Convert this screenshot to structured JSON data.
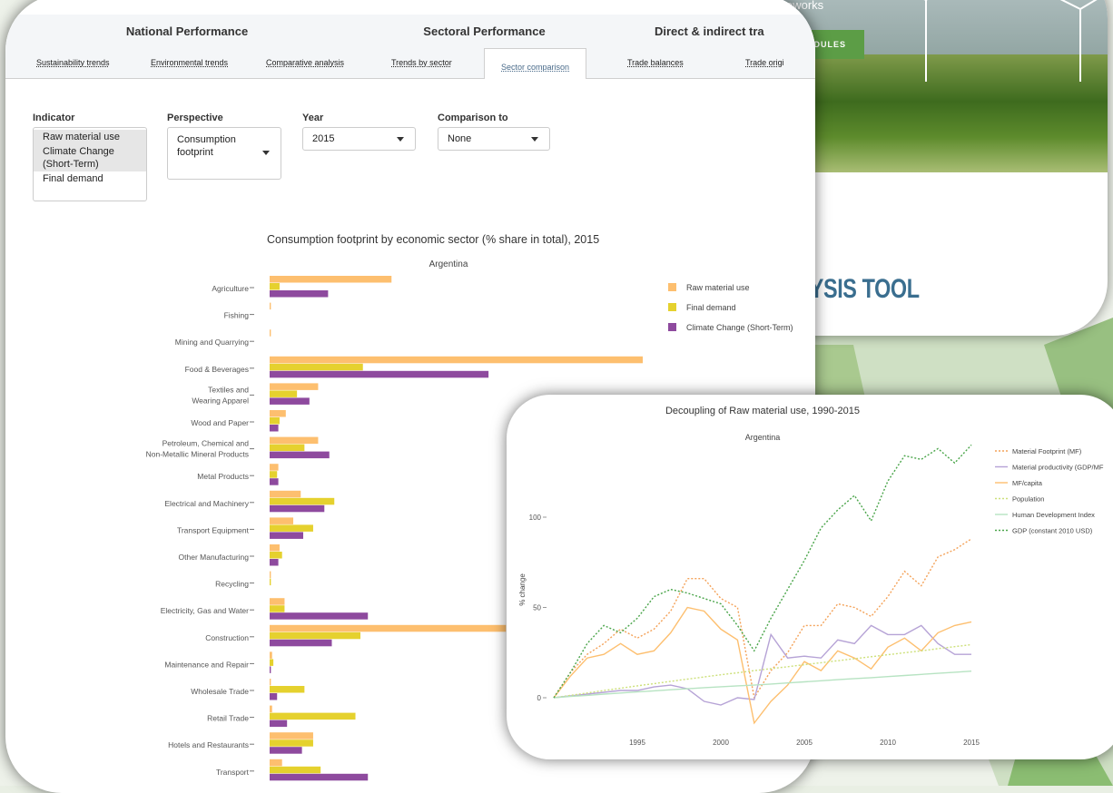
{
  "hero": {
    "subtitle": "frameworks",
    "button_label": "W MODULES",
    "dots": "■■■■",
    "heading": "LYSIS TOOL"
  },
  "tabs": {
    "groups": [
      {
        "title": "National Performance",
        "subtabs": [
          "Sustainability trends",
          "Environmental trends",
          "Comparative analysis"
        ]
      },
      {
        "title": "Sectoral Performance",
        "subtabs": [
          "Trends by sector",
          "Sector comparison"
        ]
      },
      {
        "title": "Direct & indirect tra",
        "subtabs": [
          "Trade balances",
          "Trade origi"
        ]
      }
    ],
    "active_subtab": "Sector comparison"
  },
  "controls": {
    "indicator_label": "Indicator",
    "indicator_options": [
      "Raw material use",
      "Climate Change (Short-Term)",
      "Final demand"
    ],
    "perspective_label": "Perspective",
    "perspective_value": "Consumption footprint",
    "year_label": "Year",
    "year_value": "2015",
    "comparison_label": "Comparison to",
    "comparison_value": "None"
  },
  "colors": {
    "raw_material": "#fdbf6f",
    "final_demand": "#e5d12e",
    "climate": "#8e4a9e",
    "accent": "#5c9d46",
    "mf_dotted": "#f4a259",
    "mat_productivity": "#b6a3d6",
    "mf_capita": "#fdbf6f",
    "population": "#cde07a",
    "hdi": "#b7e3c2",
    "gdp": "#4aa54a"
  },
  "chart_data": [
    {
      "type": "bar",
      "orientation": "horizontal",
      "title": "Consumption footprint by economic sector (% share in total), 2015",
      "subtitle": "Argentina",
      "legend_position": "top-right",
      "categories": [
        "Agriculture",
        "Fishing",
        "Mining and Quarrying",
        "Food & Beverages",
        "Textiles and\nWearing Apparel",
        "Wood and Paper",
        "Petroleum, Chemical and\nNon-Metallic Mineral Products",
        "Metal Products",
        "Electrical and Machinery",
        "Transport Equipment",
        "Other Manufacturing",
        "Recycling",
        "Electricity, Gas and Water",
        "Construction",
        "Maintenance and Repair",
        "Wholesale Trade",
        "Retail Trade",
        "Hotels and Restaurants",
        "Transport"
      ],
      "series": [
        {
          "name": "Raw material use",
          "values": [
            9.8,
            0.1,
            0.1,
            30.0,
            3.9,
            1.3,
            3.9,
            0.7,
            2.5,
            1.9,
            0.8,
            0.1,
            1.2,
            19.0,
            0.2,
            0.1,
            0.2,
            3.5,
            1.0
          ]
        },
        {
          "name": "Final demand",
          "values": [
            0.8,
            0.0,
            0.0,
            7.5,
            2.2,
            0.8,
            2.8,
            0.6,
            5.2,
            3.5,
            1.0,
            0.1,
            1.2,
            7.3,
            0.3,
            2.8,
            6.9,
            3.5,
            4.1
          ]
        },
        {
          "name": "Climate Change (Short-Term)",
          "values": [
            4.7,
            0.0,
            0.0,
            17.6,
            3.2,
            0.7,
            4.8,
            0.7,
            4.4,
            2.7,
            0.7,
            0.0,
            7.9,
            5.0,
            0.1,
            0.6,
            1.4,
            2.6,
            7.9
          ]
        }
      ]
    },
    {
      "type": "line",
      "title": "Decoupling of Raw material use, 1990-2015",
      "subtitle": "Argentina",
      "ylabel": "% change",
      "xlim": [
        1990,
        2015
      ],
      "ylim": [
        -20,
        140
      ],
      "x_ticks": [
        1995,
        2000,
        2005,
        2010,
        2015
      ],
      "y_ticks": [
        0,
        50,
        100
      ],
      "legend_position": "top-right",
      "x": [
        1990,
        1991,
        1992,
        1993,
        1994,
        1995,
        1996,
        1997,
        1998,
        1999,
        2000,
        2001,
        2002,
        2003,
        2004,
        2005,
        2006,
        2007,
        2008,
        2009,
        2010,
        2011,
        2012,
        2013,
        2014,
        2015
      ],
      "series": [
        {
          "name": "Material Footprint (MF)",
          "values": [
            0,
            14,
            24,
            30,
            38,
            33,
            38,
            48,
            66,
            66,
            55,
            50,
            0,
            15,
            25,
            40,
            40,
            52,
            50,
            45,
            56,
            70,
            62,
            78,
            82,
            88
          ]
        },
        {
          "name": "Material productivity (GDP/MF",
          "values": [
            0,
            1,
            2,
            3,
            4,
            4,
            6,
            7,
            5,
            -2,
            -4,
            0,
            -1,
            35,
            22,
            23,
            22,
            32,
            30,
            40,
            35,
            35,
            40,
            30,
            24,
            24
          ]
        },
        {
          "name": "MF/capita",
          "values": [
            0,
            12,
            22,
            24,
            30,
            24,
            26,
            36,
            50,
            48,
            38,
            32,
            -14,
            -2,
            7,
            20,
            15,
            26,
            22,
            16,
            28,
            33,
            26,
            36,
            40,
            42
          ]
        },
        {
          "name": "Population",
          "values": [
            0,
            1.3,
            2.6,
            4.0,
            5.3,
            6.6,
            7.8,
            9.1,
            10.3,
            11.5,
            12.7,
            13.8,
            15.0,
            16.1,
            17.2,
            18.3,
            19.4,
            20.5,
            21.6,
            22.7,
            23.8,
            24.9,
            26.0,
            27.2,
            28.3,
            29.4
          ]
        },
        {
          "name": "Human Development Index",
          "values": [
            0,
            0.7,
            1.3,
            2.0,
            2.6,
            3.2,
            3.8,
            4.4,
            5.0,
            5.6,
            6.1,
            6.6,
            7.0,
            7.6,
            8.2,
            8.8,
            9.4,
            10.0,
            10.6,
            11.1,
            11.7,
            12.3,
            12.9,
            13.5,
            14.1,
            14.7
          ]
        },
        {
          "name": "GDP (constant 2010 USD)",
          "values": [
            0,
            14,
            30,
            40,
            36,
            44,
            56,
            60,
            58,
            55,
            52,
            40,
            26,
            44,
            60,
            76,
            94,
            104,
            112,
            98,
            120,
            134,
            132,
            138,
            130,
            140
          ]
        }
      ]
    }
  ]
}
